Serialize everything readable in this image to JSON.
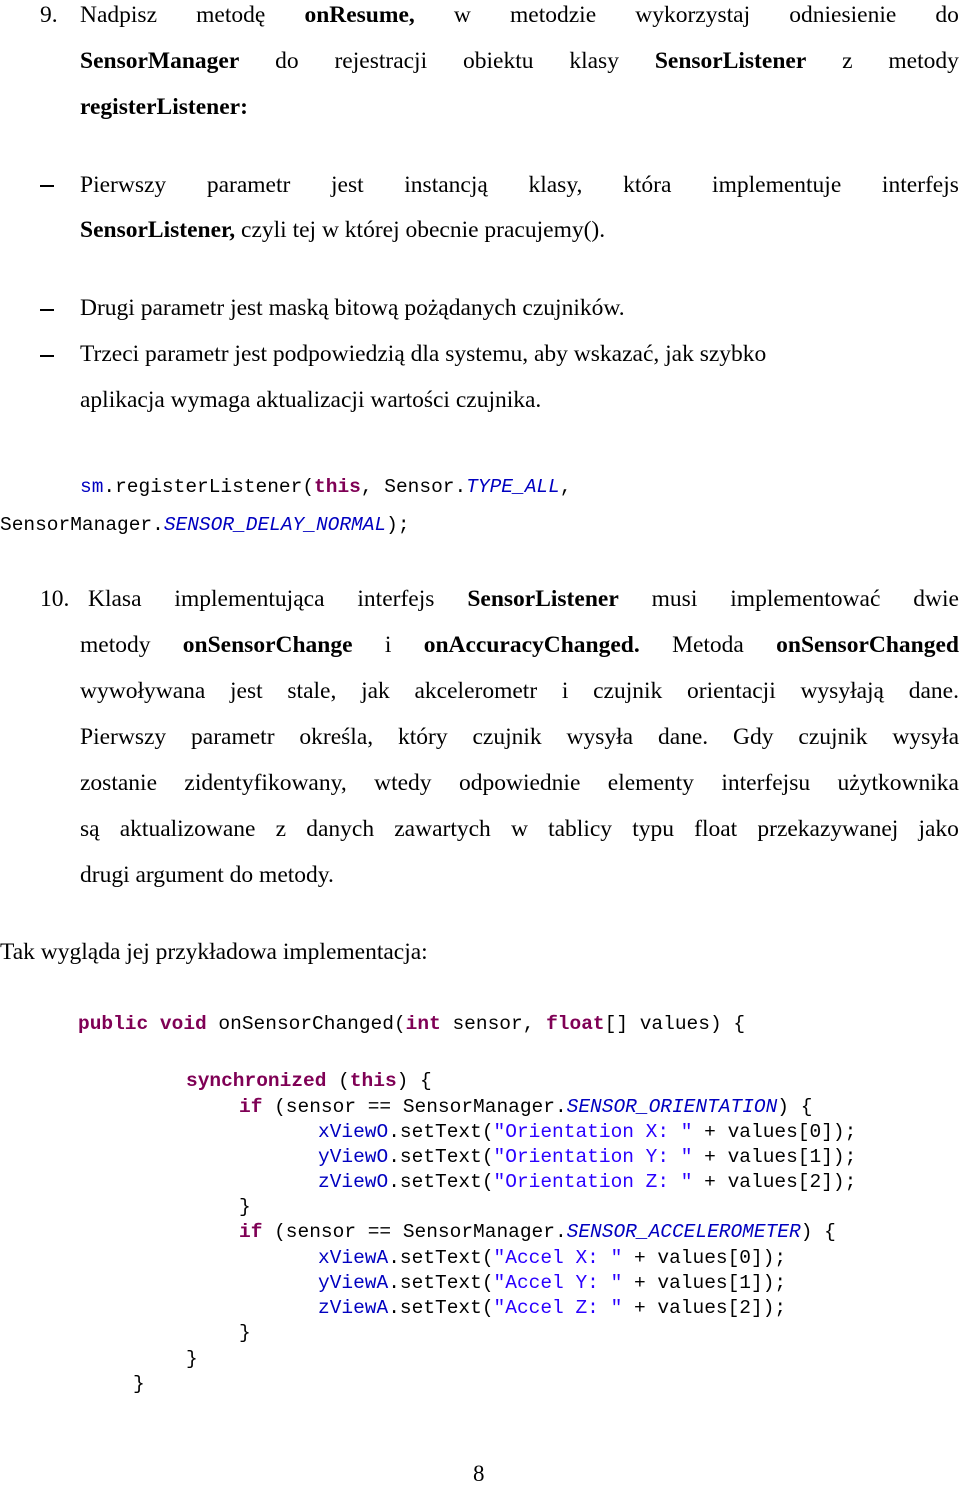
{
  "item9": {
    "number": "9.",
    "line1": [
      "Nadpisz",
      "metodę",
      "onResume,",
      "w",
      "metodzie",
      "wykorzystaj",
      "odniesienie",
      "do"
    ],
    "line2": [
      "SensorManager",
      "do",
      "rejestracji",
      "obiektu",
      "klasy",
      "SensorListener",
      "z",
      "metody"
    ],
    "line3": "registerListener:",
    "bullets": [
      {
        "line1": [
          "Pierwszy",
          "parametr",
          "jest",
          "instancją",
          "klasy,",
          "która",
          "implementuje",
          "interfejs"
        ],
        "line2_bold": "SensorListener,",
        "line2_rest": " czyli tej w której obecnie pracujemy()."
      },
      {
        "line1_text": "Drugi parametr jest maską bitową pożądanych czujników."
      },
      {
        "line1_text": "Trzeci parametr jest podpowiedzią dla systemu, aby wskazać, jak szybko",
        "line2_text": "aplikacja wymaga aktualizacji wartości czujnika."
      }
    ],
    "code": {
      "line1": {
        "obj": "sm",
        "method": ".registerListener(",
        "kw": "this",
        "mid": ", Sensor.",
        "field": "TYPE_ALL",
        "end": ","
      },
      "line2": {
        "cls": "SensorManager.",
        "field": "SENSOR_DELAY_NORMAL",
        "end": ");"
      }
    }
  },
  "item10": {
    "number": "10.",
    "lines": [
      [
        "Klasa",
        "implementująca",
        "interfejs",
        "SensorListener",
        "musi",
        "implementować",
        "dwie"
      ],
      [
        "metody",
        "onSensorChange",
        "i",
        "onAccuracyChanged.",
        "Metoda",
        "onSensorChanged"
      ],
      [
        "wywoływana",
        "jest",
        "stale,",
        "jak",
        "akcelerometr",
        "i",
        "czujnik",
        "orientacji",
        "wysyłają",
        "dane."
      ],
      [
        "Pierwszy",
        "parametr",
        "określa,",
        "który",
        "czujnik",
        "wysyła",
        "dane.",
        "Gdy",
        "czujnik",
        "wysyła"
      ],
      [
        "zostanie",
        "zidentyfikowany,",
        "wtedy",
        "odpowiednie",
        "elementy",
        "interfejsu",
        "użytkownika"
      ],
      [
        "są",
        "aktualizowane",
        "z",
        "danych",
        "zawartych",
        "w",
        "tablicy",
        "typu",
        "float",
        "przekazywanej",
        "jako"
      ]
    ],
    "last_line": "drugi argument do metody."
  },
  "intro": "Tak wygląda jej przykładowa implementacja:",
  "code_block": {
    "sig": {
      "kw1": "public",
      "kw2": "void",
      "name": " onSensorChanged(",
      "kw3": "int",
      "p1": " sensor, ",
      "kw4": "float",
      "p2": "[] values) {"
    },
    "sync": {
      "kw": "synchronized",
      "open": " (",
      "this": "this",
      "close": ") {"
    },
    "if1": {
      "kw": "if",
      "cond": " (sensor == SensorManager.",
      "field": "SENSOR_ORIENTATION",
      "end": ") {"
    },
    "orient": [
      {
        "var": "xViewO",
        "call": ".setText(",
        "str": "\"Orientation X: \"",
        "rest": " + values[0]);"
      },
      {
        "var": "yViewO",
        "call": ".setText(",
        "str": "\"Orientation Y: \"",
        "rest": " + values[1]);"
      },
      {
        "var": "zViewO",
        "call": ".setText(",
        "str": "\"Orientation Z: \"",
        "rest": " + values[2]);"
      }
    ],
    "if2": {
      "kw": "if",
      "cond": " (sensor == SensorManager.",
      "field": "SENSOR_ACCELEROMETER",
      "end": ") {"
    },
    "accel": [
      {
        "var": "xViewA",
        "call": ".setText(",
        "str": "\"Accel X: \"",
        "rest": " + values[0]);"
      },
      {
        "var": "yViewA",
        "call": ".setText(",
        "str": "\"Accel Y: \"",
        "rest": " + values[1]);"
      },
      {
        "var": "zViewA",
        "call": ".setText(",
        "str": "\"Accel Z: \"",
        "rest": " + values[2]);"
      }
    ],
    "brace": "}"
  },
  "page_number": "8"
}
